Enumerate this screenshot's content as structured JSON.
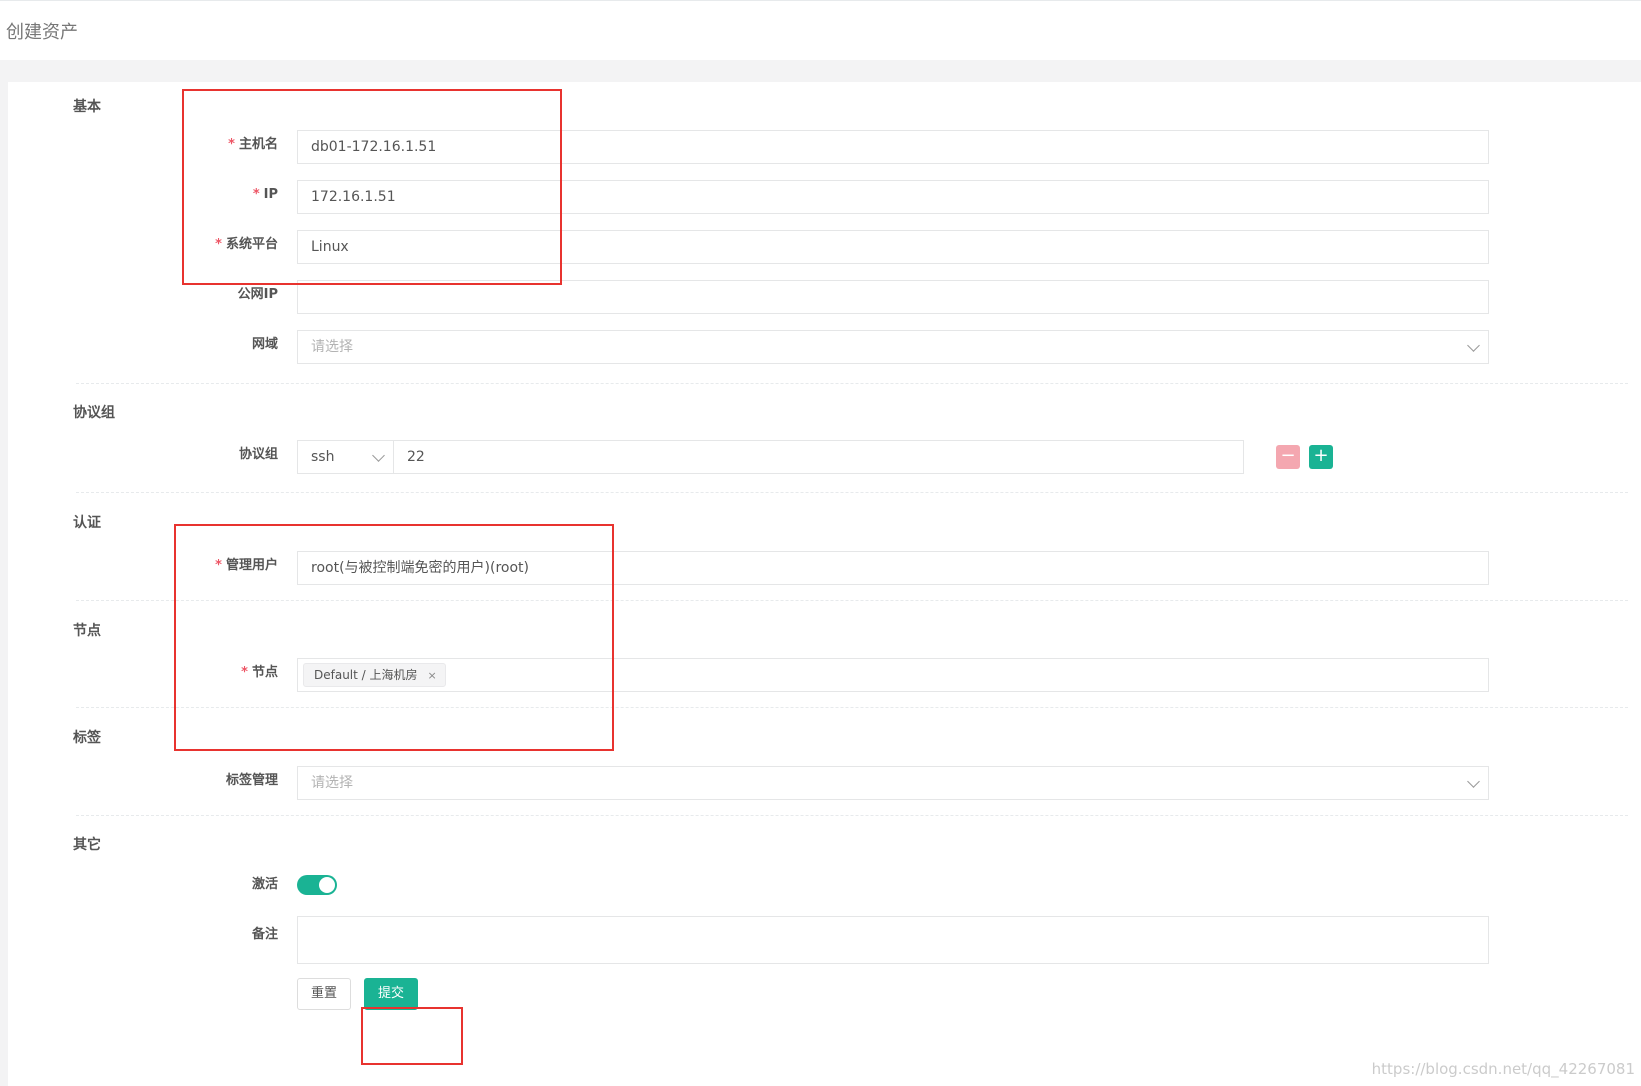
{
  "page": {
    "title": "创建资产"
  },
  "sections": {
    "basic": "基本",
    "protocol": "协议组",
    "auth": "认证",
    "node": "节点",
    "tags": "标签",
    "other": "其它"
  },
  "fields": {
    "hostname": {
      "label": "主机名",
      "value": "db01-172.16.1.51"
    },
    "ip": {
      "label": "IP",
      "value": "172.16.1.51"
    },
    "platform": {
      "label": "系统平台",
      "value": "Linux"
    },
    "public_ip": {
      "label": "公网IP",
      "value": ""
    },
    "domain": {
      "label": "网域",
      "placeholder": "请选择"
    },
    "protocol": {
      "label": "协议组",
      "type": "ssh",
      "port": "22"
    },
    "admin_user": {
      "label": "管理用户",
      "value": "root(与被控制端免密的用户)(root)"
    },
    "node": {
      "label": "节点",
      "tag": "Default / 上海机房",
      "tag_close": "×"
    },
    "labels": {
      "label": "标签管理",
      "placeholder": "请选择"
    },
    "active": {
      "label": "激活",
      "on": true
    },
    "comment": {
      "label": "备注",
      "value": ""
    }
  },
  "required_mark": "*",
  "buttons": {
    "reset": "重置",
    "submit": "提交",
    "remove_protocol": "−",
    "add_protocol": "+"
  },
  "colors": {
    "primary": "#1ab394",
    "danger_light": "#f4a7b0",
    "highlight": "#e8332f",
    "required": "#ed5565"
  },
  "watermark": "https://blog.csdn.net/qq_42267081"
}
